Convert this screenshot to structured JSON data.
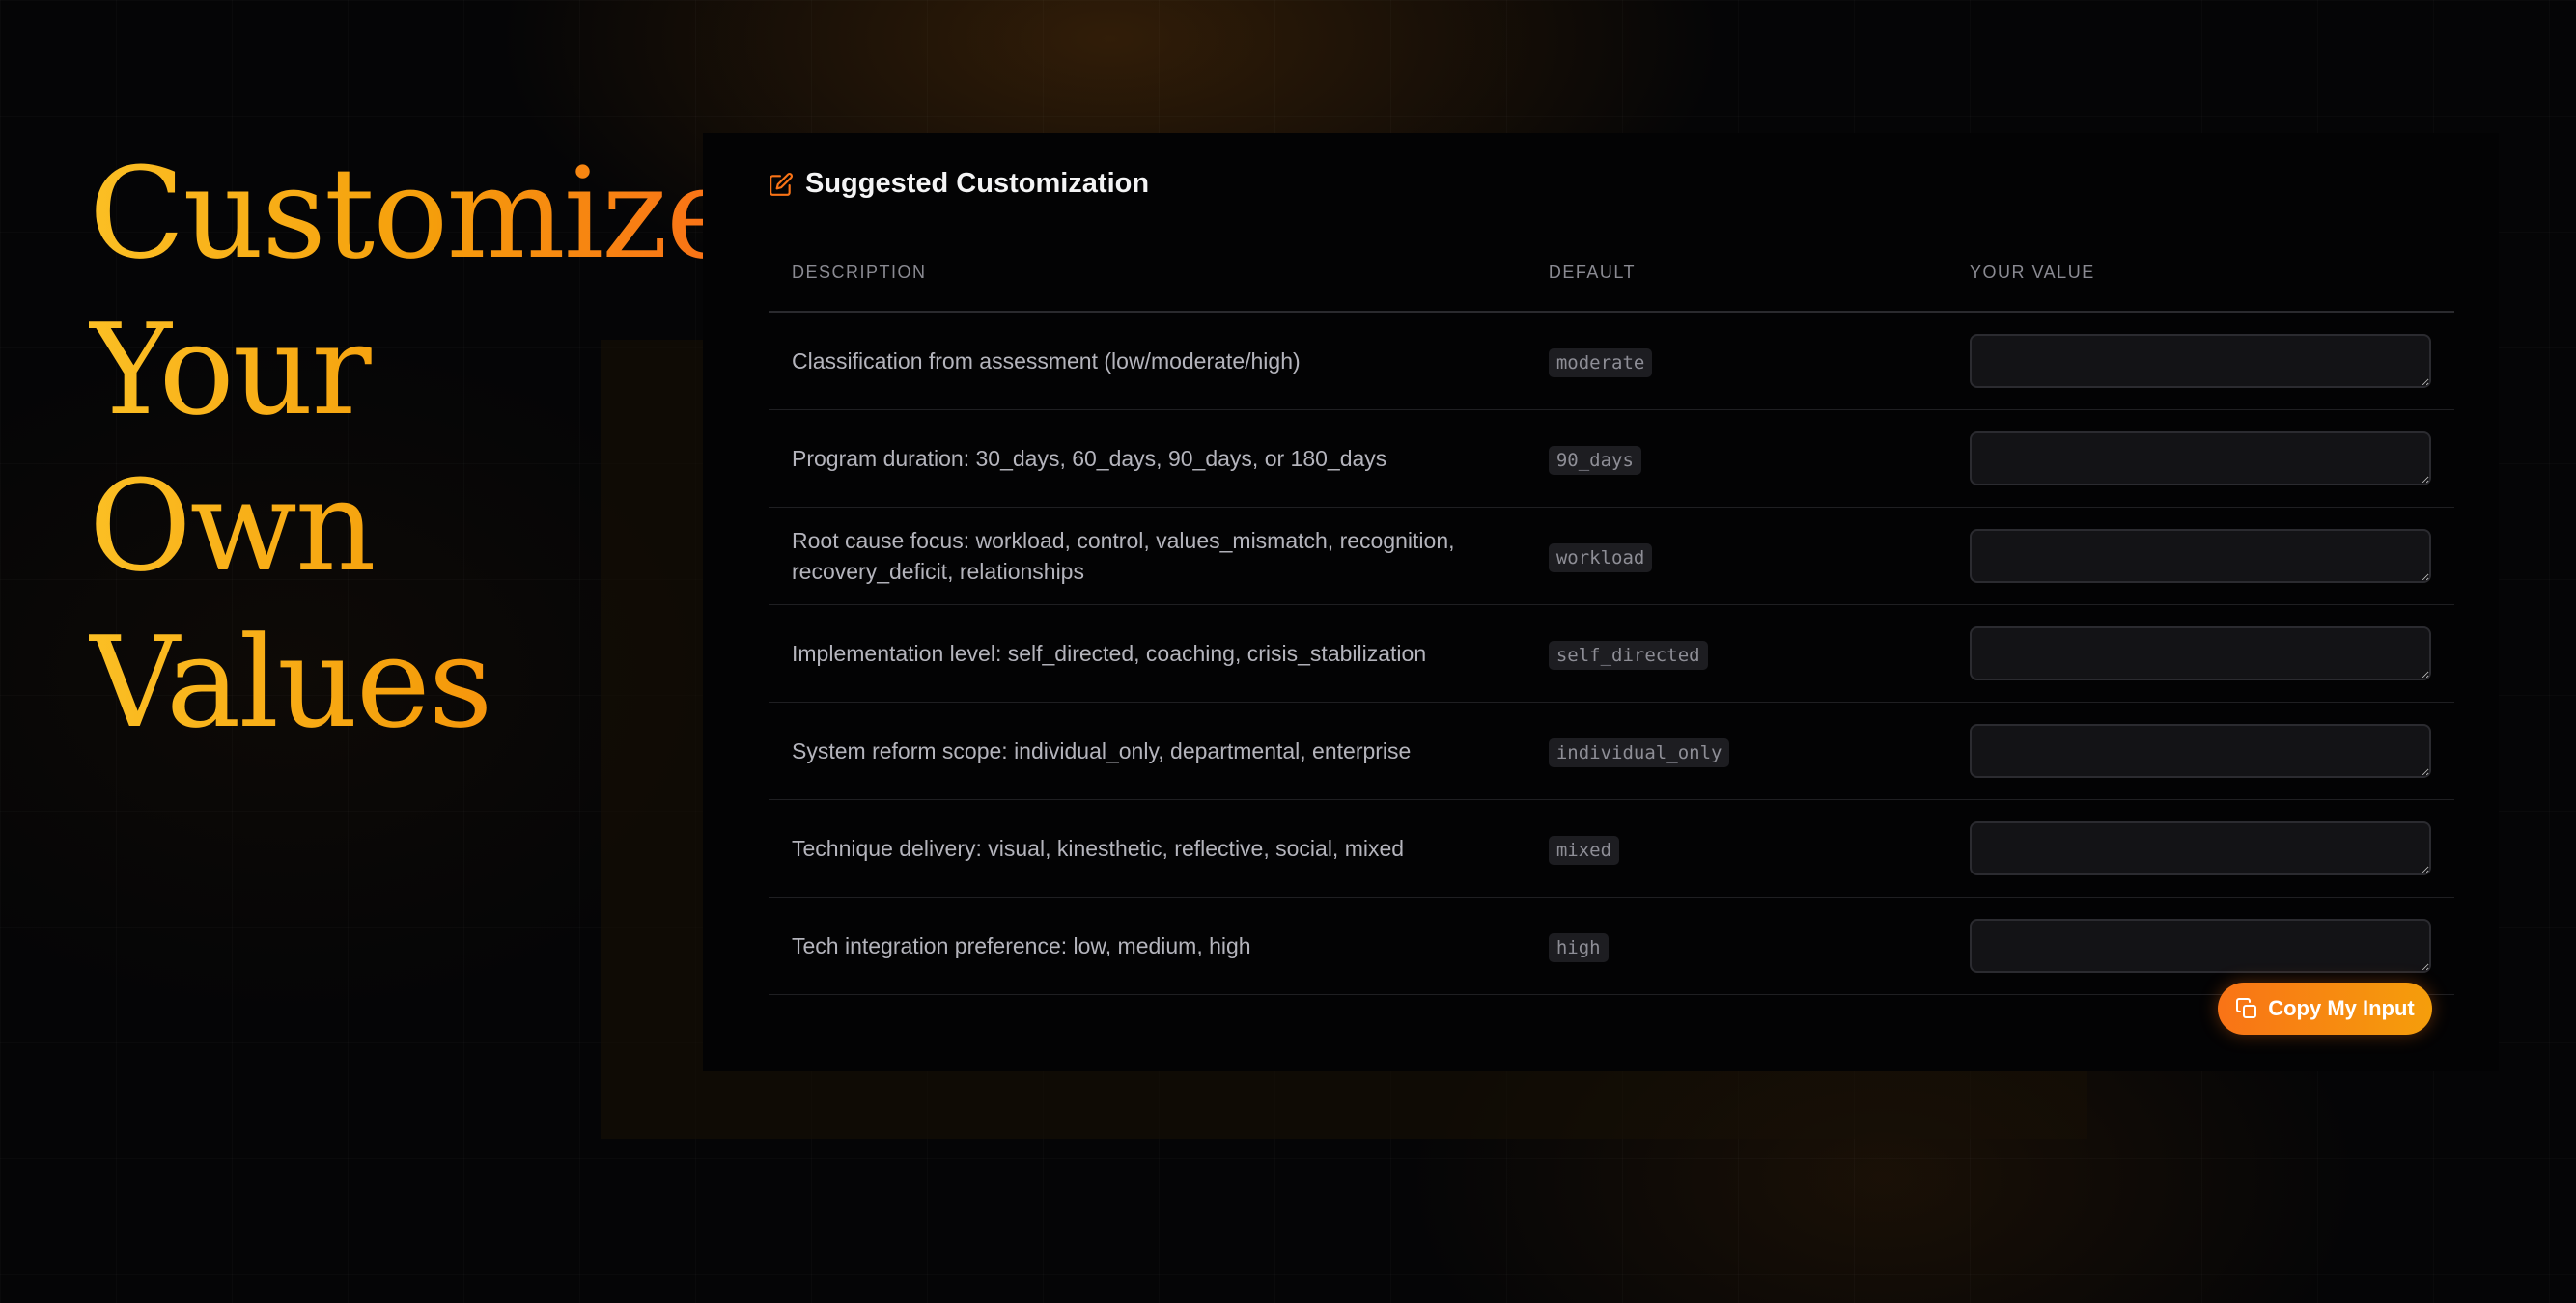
{
  "hero": {
    "lines": [
      "Customize",
      "Your",
      "Own",
      "Values"
    ]
  },
  "panel": {
    "title": "Suggested Customization",
    "icon": "edit-icon",
    "columns": {
      "description": "DESCRIPTION",
      "default": "DEFAULT",
      "your_value": "YOUR VALUE"
    },
    "rows": [
      {
        "description": "Classification from assessment (low/moderate/high)",
        "default": "moderate",
        "value": ""
      },
      {
        "description": "Program duration: 30_days, 60_days, 90_days, or 180_days",
        "default": "90_days",
        "value": ""
      },
      {
        "description": "Root cause focus: workload, control, values_mismatch, recognition, recovery_deficit, relationships",
        "default": "workload",
        "value": ""
      },
      {
        "description": "Implementation level: self_directed, coaching, crisis_stabilization",
        "default": "self_directed",
        "value": ""
      },
      {
        "description": "System reform scope: individual_only, departmental, enterprise",
        "default": "individual_only",
        "value": ""
      },
      {
        "description": "Technique delivery: visual, kinesthetic, reflective, social, mixed",
        "default": "mixed",
        "value": ""
      },
      {
        "description": "Tech integration preference: low, medium, high",
        "default": "high",
        "value": ""
      }
    ],
    "copy_button": {
      "label": "Copy My Input",
      "icon": "copy-icon"
    }
  },
  "colors": {
    "accent": "#f97316",
    "accent_light": "#fbbf24",
    "background": "#050506",
    "panel": "#030304"
  }
}
